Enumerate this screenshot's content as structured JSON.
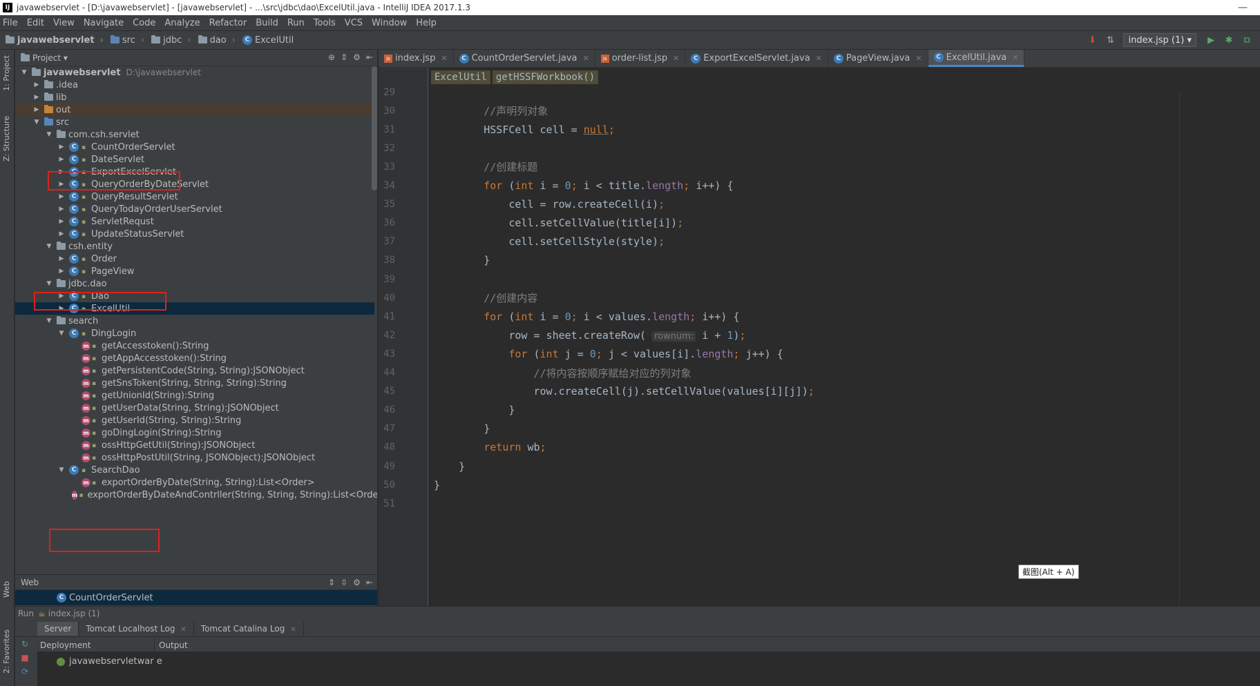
{
  "window": {
    "title": "javawebservlet - [D:\\javawebservlet] - [javawebservlet] - ...\\src\\jdbc\\dao\\ExcelUtil.java - IntelliJ IDEA 2017.1.3",
    "minimize": "—",
    "app_icon_text": "IJ"
  },
  "menu": [
    "File",
    "Edit",
    "View",
    "Navigate",
    "Code",
    "Analyze",
    "Refactor",
    "Build",
    "Run",
    "Tools",
    "VCS",
    "Window",
    "Help"
  ],
  "navbar": {
    "crumbs": [
      "javawebservlet",
      "src",
      "jdbc",
      "dao",
      "ExcelUtil"
    ],
    "run_config": "index.jsp (1) ▾"
  },
  "left_strip": {
    "project": "1: Project",
    "structure": "Z: Structure",
    "web": "Web",
    "favorites": "2: Favorites"
  },
  "project_panel": {
    "title": "Project ▾",
    "tree": [
      {
        "label": "javawebservlet",
        "extra": "D:\\javawebservlet",
        "indent": 0,
        "arrow": "▼",
        "icon": "module",
        "bold": true
      },
      {
        "label": ".idea",
        "indent": 1,
        "arrow": "▶",
        "icon": "folder"
      },
      {
        "label": "lib",
        "indent": 1,
        "arrow": "▶",
        "icon": "folder"
      },
      {
        "label": "out",
        "indent": 1,
        "arrow": "▶",
        "icon": "folder-orange",
        "highlight": true
      },
      {
        "label": "src",
        "indent": 1,
        "arrow": "▼",
        "icon": "folder-blue"
      },
      {
        "label": "com.csh.servlet",
        "indent": 2,
        "arrow": "▼",
        "icon": "package"
      },
      {
        "label": "CountOrderServlet",
        "indent": 3,
        "arrow": "▶",
        "icon": "class"
      },
      {
        "label": "DateServlet",
        "indent": 3,
        "arrow": "▶",
        "icon": "class"
      },
      {
        "label": "ExportExcelServlet",
        "indent": 3,
        "arrow": "▶",
        "icon": "class"
      },
      {
        "label": "QueryOrderByDateServlet",
        "indent": 3,
        "arrow": "▶",
        "icon": "class"
      },
      {
        "label": "QueryResultServlet",
        "indent": 3,
        "arrow": "▶",
        "icon": "class"
      },
      {
        "label": "QueryTodayOrderUserServlet",
        "indent": 3,
        "arrow": "▶",
        "icon": "class"
      },
      {
        "label": "ServletRequst",
        "indent": 3,
        "arrow": "▶",
        "icon": "class"
      },
      {
        "label": "UpdateStatusServlet",
        "indent": 3,
        "arrow": "▶",
        "icon": "class"
      },
      {
        "label": "csh.entity",
        "indent": 2,
        "arrow": "▼",
        "icon": "package"
      },
      {
        "label": "Order",
        "indent": 3,
        "arrow": "▶",
        "icon": "class"
      },
      {
        "label": "PageView",
        "indent": 3,
        "arrow": "▶",
        "icon": "class"
      },
      {
        "label": "jdbc.dao",
        "indent": 2,
        "arrow": "▼",
        "icon": "package"
      },
      {
        "label": "Dao",
        "indent": 3,
        "arrow": "▶",
        "icon": "class"
      },
      {
        "label": "ExcelUtil",
        "indent": 3,
        "arrow": "▶",
        "icon": "class",
        "selected": true
      },
      {
        "label": "search",
        "indent": 2,
        "arrow": "▼",
        "icon": "package"
      },
      {
        "label": "DingLogin",
        "indent": 3,
        "arrow": "▼",
        "icon": "class"
      },
      {
        "label": "getAccesstoken():String",
        "indent": 4,
        "arrow": "",
        "icon": "method"
      },
      {
        "label": "getAppAccesstoken():String",
        "indent": 4,
        "arrow": "",
        "icon": "method"
      },
      {
        "label": "getPersistentCode(String, String):JSONObject",
        "indent": 4,
        "arrow": "",
        "icon": "method"
      },
      {
        "label": "getSnsToken(String, String, String):String",
        "indent": 4,
        "arrow": "",
        "icon": "method"
      },
      {
        "label": "getUnionId(String):String",
        "indent": 4,
        "arrow": "",
        "icon": "method"
      },
      {
        "label": "getUserData(String, String):JSONObject",
        "indent": 4,
        "arrow": "",
        "icon": "method"
      },
      {
        "label": "getUserId(String, String):String",
        "indent": 4,
        "arrow": "",
        "icon": "method"
      },
      {
        "label": "goDingLogin(String):String",
        "indent": 4,
        "arrow": "",
        "icon": "method"
      },
      {
        "label": "ossHttpGetUtil(String):JSONObject",
        "indent": 4,
        "arrow": "",
        "icon": "method"
      },
      {
        "label": "ossHttpPostUtil(String, JSONObject):JSONObject",
        "indent": 4,
        "arrow": "",
        "icon": "method"
      },
      {
        "label": "SearchDao",
        "indent": 3,
        "arrow": "▼",
        "icon": "class"
      },
      {
        "label": "exportOrderByDate(String, String):List<Order>",
        "indent": 4,
        "arrow": "",
        "icon": "method"
      },
      {
        "label": "exportOrderByDateAndContrller(String, String, String):List<Order>",
        "indent": 4,
        "arrow": "",
        "icon": "method"
      }
    ]
  },
  "web_panel": {
    "title": "Web",
    "item": "CountOrderServlet"
  },
  "editor_tabs": [
    {
      "label": "index.jsp",
      "icon": "jsp"
    },
    {
      "label": "CountOrderServlet.java",
      "icon": "class"
    },
    {
      "label": "order-list.jsp",
      "icon": "jsp"
    },
    {
      "label": "ExportExcelServlet.java",
      "icon": "class"
    },
    {
      "label": "PageView.java",
      "icon": "class"
    },
    {
      "label": "ExcelUtil.java",
      "icon": "class",
      "active": true
    }
  ],
  "editor": {
    "breadcrumbs": [
      "ExcelUtil",
      "getHSSFWorkbook()"
    ],
    "tooltip": "截图(Alt + A)",
    "lines": [
      {
        "n": "29",
        "parts": []
      },
      {
        "n": "30",
        "parts": [
          [
            "cm",
            "        //声明列对象"
          ]
        ]
      },
      {
        "n": "31",
        "parts": [
          [
            "",
            "        HSSFCell cell = "
          ],
          [
            "nul",
            "null"
          ],
          [
            "kw",
            ";"
          ]
        ]
      },
      {
        "n": "32",
        "parts": []
      },
      {
        "n": "33",
        "parts": [
          [
            "cm",
            "        //创建标题"
          ]
        ]
      },
      {
        "n": "34",
        "parts": [
          [
            "kw",
            "        for "
          ],
          [
            "",
            "("
          ],
          [
            "kw",
            "int "
          ],
          [
            "",
            "i = "
          ],
          [
            "num",
            "0"
          ],
          [
            "kw",
            "; "
          ],
          [
            "",
            "i < title."
          ],
          [
            "fld",
            "length"
          ],
          [
            "kw",
            "; "
          ],
          [
            "",
            "i++) {"
          ]
        ]
      },
      {
        "n": "35",
        "parts": [
          [
            "",
            "            cell = row.createCell(i)"
          ],
          [
            "kw",
            ";"
          ]
        ]
      },
      {
        "n": "36",
        "parts": [
          [
            "",
            "            cell.setCellValue(title[i])"
          ],
          [
            "kw",
            ";"
          ]
        ]
      },
      {
        "n": "37",
        "parts": [
          [
            "",
            "            cell.setCellStyle(style)"
          ],
          [
            "kw",
            ";"
          ]
        ]
      },
      {
        "n": "38",
        "parts": [
          [
            "",
            "        }"
          ]
        ]
      },
      {
        "n": "39",
        "parts": []
      },
      {
        "n": "40",
        "parts": [
          [
            "cm",
            "        //创建内容"
          ]
        ]
      },
      {
        "n": "41",
        "parts": [
          [
            "kw",
            "        for "
          ],
          [
            "",
            "("
          ],
          [
            "kw",
            "int "
          ],
          [
            "",
            "i = "
          ],
          [
            "num",
            "0"
          ],
          [
            "kw",
            "; "
          ],
          [
            "",
            "i < values."
          ],
          [
            "fld",
            "length"
          ],
          [
            "kw",
            "; "
          ],
          [
            "",
            "i++) {"
          ]
        ]
      },
      {
        "n": "42",
        "parts": [
          [
            "",
            "            row = sheet.createRow( "
          ],
          [
            "hint",
            "rownum:"
          ],
          [
            "",
            " i + "
          ],
          [
            "num",
            "1"
          ],
          [
            "",
            ")"
          ],
          [
            "kw",
            ";"
          ]
        ]
      },
      {
        "n": "43",
        "parts": [
          [
            "kw",
            "            for "
          ],
          [
            "",
            "("
          ],
          [
            "kw",
            "int "
          ],
          [
            "",
            "j = "
          ],
          [
            "num",
            "0"
          ],
          [
            "kw",
            "; "
          ],
          [
            "",
            "j < values[i]."
          ],
          [
            "fld",
            "length"
          ],
          [
            "kw",
            "; "
          ],
          [
            "",
            "j++) {"
          ]
        ]
      },
      {
        "n": "44",
        "parts": [
          [
            "cm",
            "                //将内容按顺序赋给对应的列对象"
          ]
        ]
      },
      {
        "n": "45",
        "parts": [
          [
            "",
            "                row.createCell(j).setCellValue(values[i][j])"
          ],
          [
            "kw",
            ";"
          ]
        ]
      },
      {
        "n": "46",
        "parts": [
          [
            "",
            "            }"
          ]
        ]
      },
      {
        "n": "47",
        "parts": [
          [
            "",
            "        }"
          ]
        ]
      },
      {
        "n": "48",
        "parts": [
          [
            "kw",
            "        return "
          ],
          [
            "",
            "wb"
          ],
          [
            "kw",
            ";"
          ]
        ]
      },
      {
        "n": "49",
        "parts": [
          [
            "",
            "    }"
          ]
        ]
      },
      {
        "n": "50",
        "parts": [
          [
            "",
            "}"
          ]
        ]
      },
      {
        "n": "51",
        "parts": []
      }
    ]
  },
  "run_panel": {
    "title": "Run",
    "config": "index.jsp (1)",
    "tabs": [
      "Server",
      "Tomcat Localhost Log",
      "Tomcat Catalina Log"
    ],
    "col_deployment": "Deployment",
    "col_output": "Output",
    "deployment_item": "javawebservletwar e"
  },
  "colors": {
    "editor_bg": "#2b2b2b",
    "panel_bg": "#3c3f41",
    "selection": "#0d293e",
    "annotation_red": "#e0201a",
    "keyword": "#cc7832",
    "number": "#6897bb",
    "comment": "#808080"
  }
}
